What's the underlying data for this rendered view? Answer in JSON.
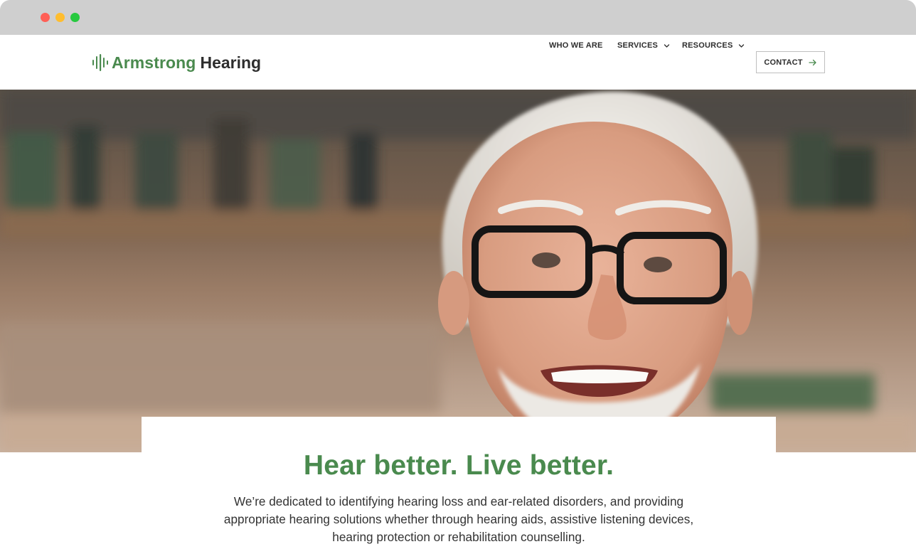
{
  "colors": {
    "brand_green": "#4a8a4e",
    "text_dark": "#2e2e2e",
    "traffic_red": "#ff5f56",
    "traffic_yellow": "#ffbd2e",
    "traffic_green": "#27c93f"
  },
  "browser": {
    "controls": [
      "close",
      "minimize",
      "maximize"
    ]
  },
  "header": {
    "logo": {
      "icon": "sound-wave-icon",
      "word1": "Armstrong",
      "word2": "Hearing"
    },
    "nav": {
      "items": [
        {
          "label": "WHO WE ARE",
          "has_dropdown": false
        },
        {
          "label": "SERVICES",
          "has_dropdown": true,
          "icon": "chevron-down-icon"
        },
        {
          "label": "RESOURCES",
          "has_dropdown": true,
          "icon": "chevron-down-icon"
        }
      ],
      "contact": {
        "label": "CONTACT",
        "icon": "arrow-right-icon"
      }
    }
  },
  "hero": {
    "image_subject": "smiling older man with glasses"
  },
  "intro": {
    "headline": "Hear better. Live better.",
    "body": "We’re dedicated to identifying hearing loss and ear-related disorders, and providing appropriate hearing solutions whether through hearing aids, assistive listening devices, hearing protection or rehabilitation counselling."
  }
}
